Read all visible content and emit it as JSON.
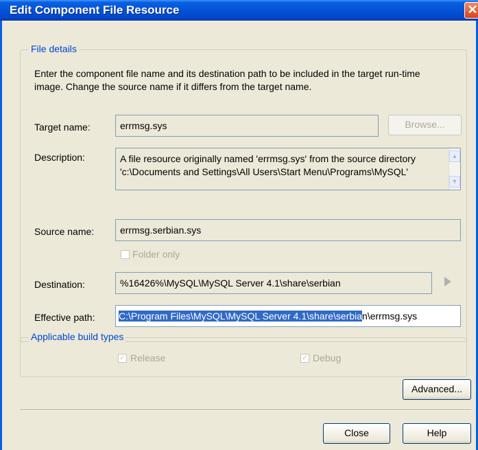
{
  "window": {
    "title": "Edit Component File Resource",
    "close_glyph": "✕"
  },
  "file_details": {
    "legend": "File details",
    "intro_line1": "Enter the component file name and its destination path to be included in the target run-time",
    "intro_line2": "image.  Change the source name if it differs from the target name.",
    "target_name_label": "Target name:",
    "target_name_value": "errmsg.sys",
    "browse_label": "Browse...",
    "description_label": "Description:",
    "description_line1": "A file resource originally named 'errmsg.sys'  from the source directory",
    "description_line2": "'c:\\Documents and Settings\\All Users\\Start Menu\\Programs\\MySQL'",
    "source_name_label": "Source name:",
    "source_name_value": "errmsg.serbian.sys",
    "folder_only_label": "Folder only",
    "destination_label": "Destination:",
    "destination_value": "%16426%\\MySQL\\MySQL Server 4.1\\share\\serbian",
    "effective_path_label": "Effective path:",
    "effective_path_selected": "C:\\Program Files\\MySQL\\MySQL Server 4.1\\share\\serbia",
    "effective_path_rest": "n\\errmsg.sys"
  },
  "build_types": {
    "legend": "Applicable build types",
    "release_label": "Release",
    "debug_label": "Debug",
    "release_checked": true,
    "debug_checked": true
  },
  "buttons": {
    "advanced": "Advanced...",
    "close": "Close",
    "help": "Help"
  },
  "colors": {
    "title_bar": "#0454d8",
    "selection": "#316ac5",
    "group_legend": "#0046d5"
  }
}
